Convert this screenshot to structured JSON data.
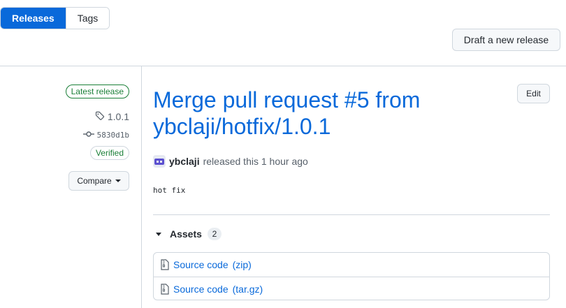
{
  "tabs": {
    "releases": "Releases",
    "tags": "Tags"
  },
  "actions": {
    "draft": "Draft a new release",
    "edit": "Edit",
    "compare": "Compare"
  },
  "sidebar": {
    "latest": "Latest release",
    "tag": "1.0.1",
    "commit": "5830d1b",
    "verified": "Verified"
  },
  "release": {
    "title_line1": "Merge pull request #5 from",
    "title_line2": "ybclaji/hotfix/1.0.1",
    "author": "ybclaji",
    "released_text": "released this 1 hour ago",
    "body": "hot fix"
  },
  "assets": {
    "label": "Assets",
    "count": "2",
    "items": [
      {
        "name": "Source code",
        "ext": "(zip)"
      },
      {
        "name": "Source code",
        "ext": "(tar.gz)"
      }
    ]
  },
  "colors": {
    "accent": "#0969da",
    "success": "#1a7f37",
    "border": "#d0d7de"
  },
  "icons": {
    "tag": "tag-icon",
    "commit": "git-commit-icon",
    "zip": "file-zip-icon",
    "caret": "triangle-down-icon"
  }
}
